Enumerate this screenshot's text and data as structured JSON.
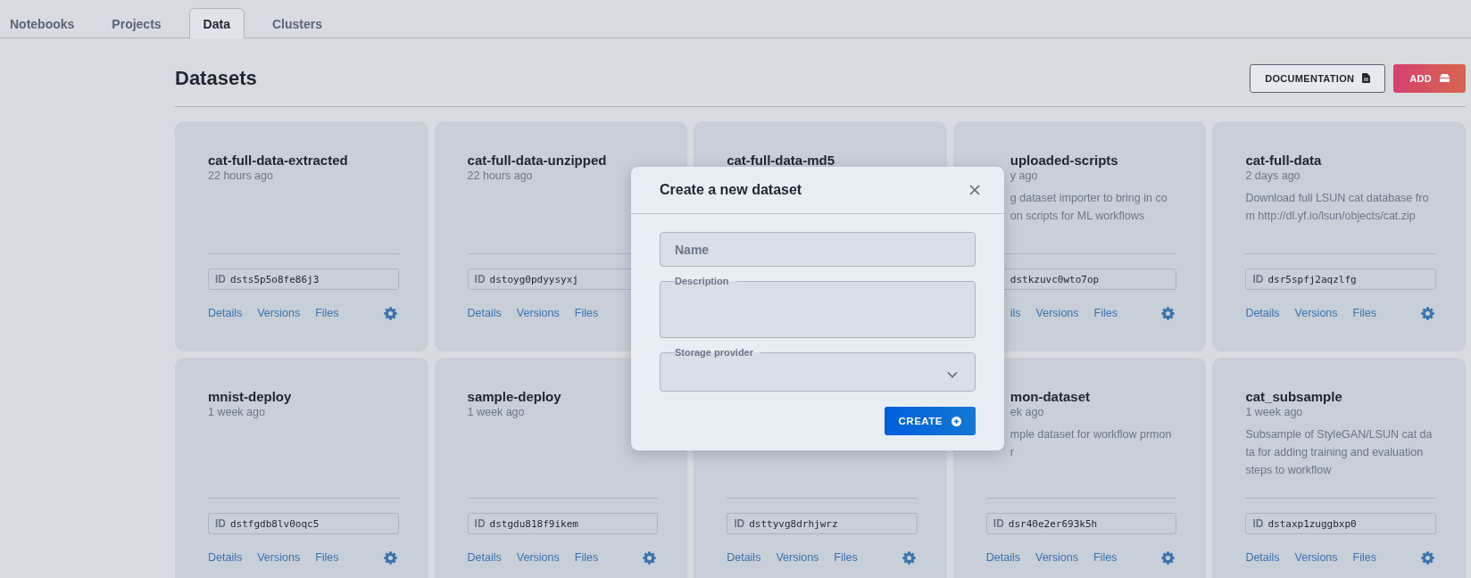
{
  "tabs": [
    {
      "label": "Notebooks",
      "selected": false
    },
    {
      "label": "Projects",
      "selected": false
    },
    {
      "label": "Data",
      "selected": true
    },
    {
      "label": "Clusters",
      "selected": false
    }
  ],
  "page_title": "Datasets",
  "actions": [
    {
      "kind": "doc",
      "label": "DOCUMENTATION"
    },
    {
      "kind": "add",
      "label": "ADD"
    }
  ],
  "cards": [
    {
      "kind": "card",
      "title": "cat-full-data-extracted",
      "time": "22 hours ago",
      "id_label": "ID",
      "id": "dsts5p5o8fe86j3",
      "links": [
        "Details",
        "Versions",
        "Files"
      ],
      "settings": true
    },
    {
      "kind": "card",
      "title": "cat-full-data-unzipped",
      "time": "22 hours ago",
      "id_label": "ID",
      "id": "dstoyg0pdyysyxj",
      "links": [
        "Details",
        "Versions",
        "Files"
      ],
      "settings": false
    },
    {
      "kind": "card",
      "title": "cat-full-data-md5",
      "settings": false
    },
    {
      "kind": "cut",
      "title": "uploaded-scripts",
      "time": "y ago",
      "description": [
        "g dataset importer to bring in co",
        "on scripts for ML workflows"
      ],
      "id": "dstkzuvc0wto7op",
      "links": [
        "ils",
        "Versions",
        "Files"
      ],
      "settings": true
    },
    {
      "kind": "card",
      "title": "cat-full-data",
      "time": "2 days ago",
      "description": [
        "Download full LSUN cat database fro",
        "m http://dl.yf.io/lsun/objects/cat.zip"
      ],
      "id_label": "ID",
      "id": "dsr5spfj2aqzlfg",
      "links": [
        "Details",
        "Versions",
        "Files"
      ],
      "settings": true
    },
    {
      "kind": "card",
      "title": "mnist-deploy",
      "time": "1 week ago",
      "id_label": "ID",
      "id": "dstfgdb8lv0oqc5",
      "links": [
        "Details",
        "Versions",
        "Files"
      ],
      "settings": true
    },
    {
      "kind": "card",
      "title": "sample-deploy",
      "time": "1 week ago",
      "id_label": "ID",
      "id": "dstgdu818f9ikem",
      "links": [
        "Details",
        "Versions",
        "Files"
      ],
      "settings": true
    },
    {
      "kind": "card",
      "id_label": "ID",
      "id": "dsttyvg8drhjwrz",
      "links": [
        "Details",
        "Versions",
        "Files"
      ],
      "settings": true
    },
    {
      "kind": "cut-upper",
      "title": "mon-dataset",
      "time": "ek ago",
      "description": [
        "mple dataset for workflow prmon",
        "r"
      ],
      "id_label": "ID",
      "id": "dsr40e2er693k5h",
      "links": [
        "Details",
        "Versions",
        "Files"
      ],
      "settings": true
    },
    {
      "kind": "card",
      "title": "cat_subsample",
      "time": "1 week ago",
      "description": [
        "Subsample of StyleGAN/LSUN cat da",
        "ta for adding training and evaluation",
        "steps to workflow"
      ],
      "id_label": "ID",
      "id": "dstaxp1zuggbxp0",
      "links": [
        "Details",
        "Versions",
        "Files"
      ],
      "settings": true
    }
  ],
  "dialog": {
    "title": "Create a new dataset",
    "name_field": {
      "placeholder": "Name"
    },
    "description_field": {
      "label": "Description"
    },
    "storage_field": {
      "label": "Storage provider"
    },
    "submit": "CREATE"
  }
}
